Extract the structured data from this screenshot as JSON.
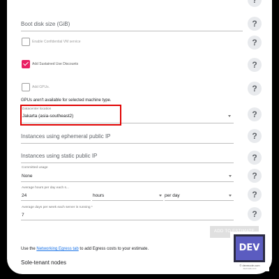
{
  "boot_disk": {
    "label": "Boot disk size (GiB)"
  },
  "checkboxes": {
    "confidential": {
      "label": "Enable Confidential VM service",
      "checked": false
    },
    "sustained": {
      "label": "Add Sustained Use Discounts",
      "checked": true
    },
    "gpus": {
      "label": "Add GPUs.",
      "checked": false
    }
  },
  "gpu_note": "GPUs aren't available for selected machine type.",
  "datacenter": {
    "label": "Datacenter location",
    "value": "Jakarta (asia-southeast2)"
  },
  "ephemeral_ip": {
    "label": "Instances using ephemeral public IP"
  },
  "static_ip": {
    "label": "Instances using static public IP"
  },
  "committed": {
    "label": "Committed usage",
    "value": "None"
  },
  "hours": {
    "label": "Average hours per day each s...",
    "value": "24",
    "unit": "hours",
    "period": "per day"
  },
  "days": {
    "label": "Average days per week each server is running *",
    "value": "7"
  },
  "actions": {
    "add_to_estimate": "ADD TO ESTIMATE"
  },
  "egress": {
    "prefix": "Use the ",
    "link": "Networking Egress tab",
    "suffix": " to add Egress costs to your estimate."
  },
  "sole_tenant": {
    "title": "Sole-tenant nodes"
  },
  "help_glyph": "?",
  "watermark": {
    "logo_text": "DEV",
    "url": "© devmode.com",
    "sub": "devmode.com"
  },
  "colors": {
    "accent_checkbox": "#e91e63",
    "highlight_border": "#e00000",
    "link": "#1a73e8"
  }
}
